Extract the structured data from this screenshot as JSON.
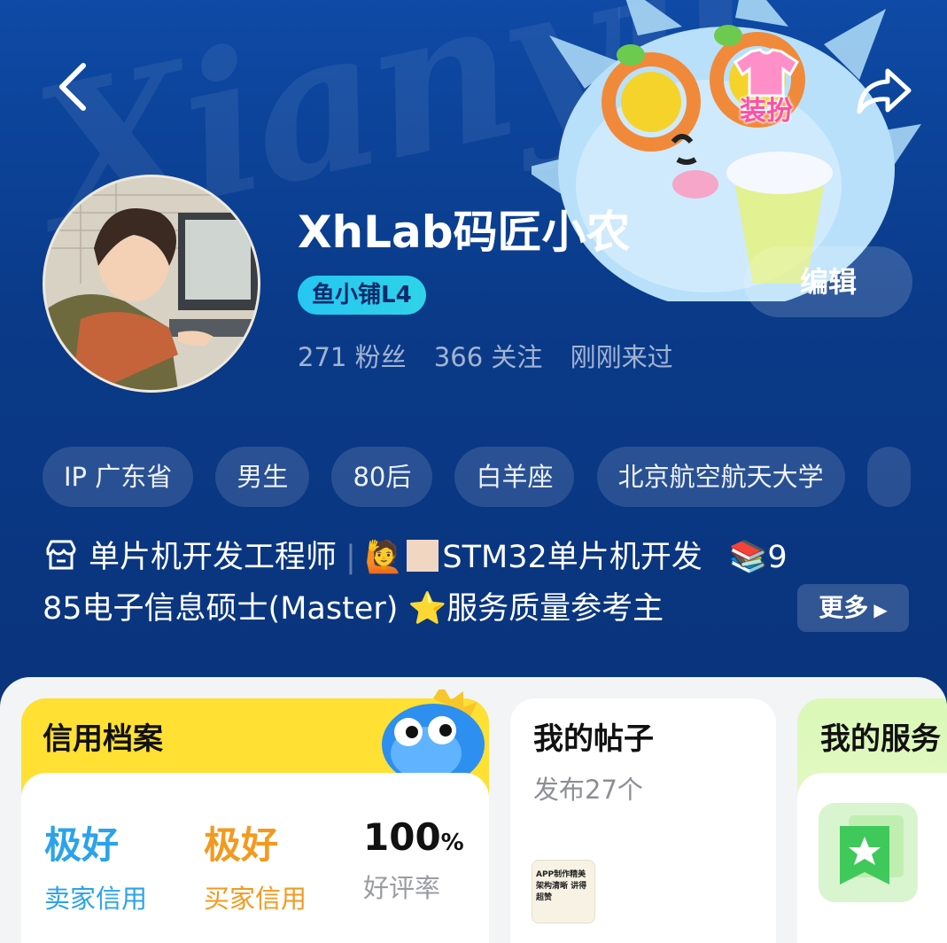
{
  "header": {
    "watermark": "Xianyu",
    "dress_up_label": "装扮"
  },
  "profile": {
    "username": "XhLab码匠小农",
    "level_badge": "鱼小铺L4",
    "edit_label": "编辑",
    "followers": "271 粉丝",
    "following": "366 关注",
    "last_seen": "刚刚来过"
  },
  "tags": [
    "IP 广东省",
    "男生",
    "80后",
    "白羊座",
    "北京航空航天大学"
  ],
  "bio": {
    "line1_part1": "单片机开发工程师",
    "line1_part2": "🙋",
    "line1_part3": "STM32单片机开发",
    "line1_part4": "📚9",
    "line2": "85电子信息硕士(Master) ⭐服务质量参考主",
    "more_label": "更多"
  },
  "credit": {
    "title": "信用档案",
    "seller_value": "极好",
    "seller_label": "卖家信用",
    "buyer_value": "极好",
    "buyer_label": "买家信用",
    "rate_value": "100",
    "rate_unit": "%",
    "rate_label": "好评率"
  },
  "posts": {
    "title": "我的帖子",
    "subtitle": "发布27个",
    "thumb_text": "APP制作精美 架构清晰 讲得超赞"
  },
  "services": {
    "title": "我的服务"
  },
  "colors": {
    "hero_bg": "#0e4aa6",
    "badge_cyan": "#26c6f2",
    "seller_blue": "#2ba3e8",
    "buyer_orange": "#f29a1f",
    "credit_yellow": "#ffe033",
    "service_green": "#dbf8b7"
  }
}
